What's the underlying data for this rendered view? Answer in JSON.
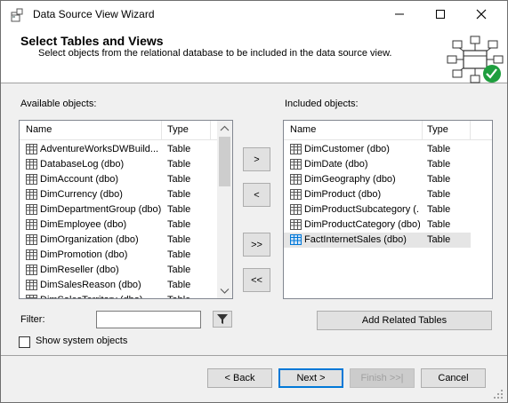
{
  "window": {
    "title": "Data Source View Wizard"
  },
  "header": {
    "title": "Select Tables and Views",
    "subtitle": "Select objects from the relational database to be included in the data source view."
  },
  "available": {
    "label": "Available objects:",
    "columns": [
      "Name",
      "Type"
    ],
    "rows": [
      {
        "name": "AdventureWorksDWBuild...",
        "type": "Table"
      },
      {
        "name": "DatabaseLog (dbo)",
        "type": "Table"
      },
      {
        "name": "DimAccount (dbo)",
        "type": "Table"
      },
      {
        "name": "DimCurrency (dbo)",
        "type": "Table"
      },
      {
        "name": "DimDepartmentGroup (dbo)",
        "type": "Table"
      },
      {
        "name": "DimEmployee (dbo)",
        "type": "Table"
      },
      {
        "name": "DimOrganization (dbo)",
        "type": "Table"
      },
      {
        "name": "DimPromotion (dbo)",
        "type": "Table"
      },
      {
        "name": "DimReseller (dbo)",
        "type": "Table"
      },
      {
        "name": "DimSalesReason (dbo)",
        "type": "Table"
      },
      {
        "name": "DimSalesTerritory (dbo)",
        "type": "Table"
      }
    ]
  },
  "included": {
    "label": "Included objects:",
    "columns": [
      "Name",
      "Type"
    ],
    "rows": [
      {
        "name": "DimCustomer (dbo)",
        "type": "Table"
      },
      {
        "name": "DimDate (dbo)",
        "type": "Table"
      },
      {
        "name": "DimGeography (dbo)",
        "type": "Table"
      },
      {
        "name": "DimProduct (dbo)",
        "type": "Table"
      },
      {
        "name": "DimProductSubcategory (...",
        "type": "Table"
      },
      {
        "name": "DimProductCategory (dbo)",
        "type": "Table"
      },
      {
        "name": "FactInternetSales (dbo)",
        "type": "Table",
        "selected": true
      }
    ]
  },
  "transfer": {
    "add": ">",
    "remove": "<",
    "add_all": ">>",
    "remove_all": "<<"
  },
  "filter": {
    "label": "Filter:",
    "value": ""
  },
  "show_system": {
    "label": "Show system objects",
    "checked": false
  },
  "add_related": "Add Related Tables",
  "footer": {
    "back": "< Back",
    "next": "Next >",
    "finish": "Finish >>|",
    "cancel": "Cancel"
  },
  "colors": {
    "accent": "#0078d7",
    "success": "#1e9e3e",
    "selection": "#e5e5e5"
  }
}
